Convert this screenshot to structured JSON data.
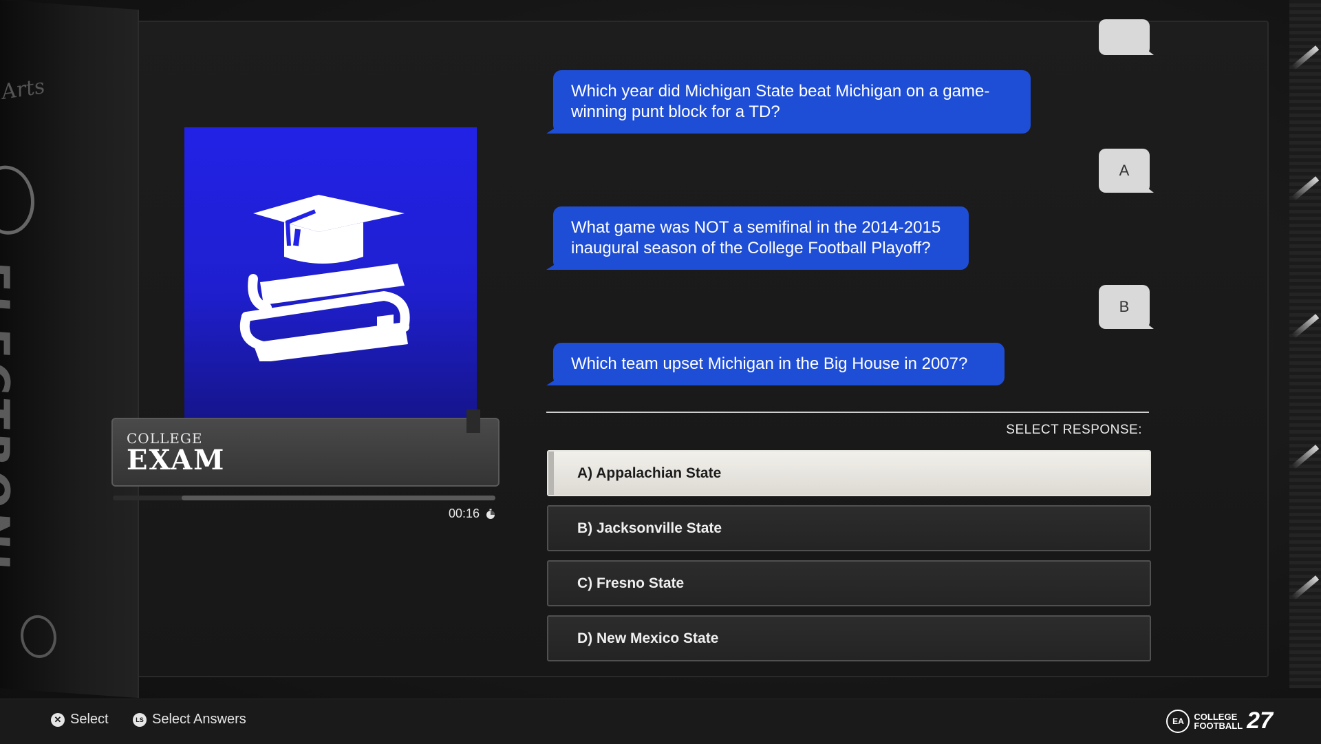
{
  "card": {
    "subtitle": "COLLEGE",
    "title": "EXAM",
    "timer": "00:16",
    "time_remaining_fraction": 0.82,
    "icon": "graduation-cap-books-icon"
  },
  "chat": {
    "messages": [
      {
        "text": "Which year did Michigan State beat Michigan on a game-winning punt block for a TD?",
        "answer": "A"
      },
      {
        "text": "What game was NOT a semifinal in the 2014-2015 inaugural season of the College Football Playoff?",
        "answer": "B"
      },
      {
        "text": "Which team upset Michigan in the Big House in 2007?"
      }
    ]
  },
  "responses": {
    "label": "SELECT RESPONSE:",
    "options": [
      "A) Appalachian State",
      "B) Jacksonville State",
      "C) Fresno State",
      "D) New Mexico State"
    ],
    "selected_index": 0
  },
  "footer": {
    "hints": [
      {
        "button": "✕",
        "label": "Select"
      },
      {
        "button": "LS",
        "label": "Select Answers"
      }
    ],
    "brand": {
      "ea": "EA",
      "line1": "COLLEGE",
      "line2": "FOOTBALL",
      "number": "27"
    }
  },
  "wall": {
    "text": "ELECTRONI",
    "script": "Arts"
  },
  "colors": {
    "accent_blue": "#1f4ed6",
    "card_blue": "#2222e6"
  }
}
